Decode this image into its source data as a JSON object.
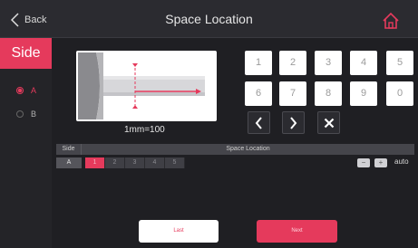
{
  "header": {
    "back_label": "Back",
    "title": "Space Location"
  },
  "sidebar": {
    "title": "Side",
    "options": [
      {
        "label": "A",
        "selected": true
      },
      {
        "label": "B",
        "selected": false
      }
    ]
  },
  "diagram": {
    "scale_label": "1mm=100"
  },
  "keypad": {
    "keys": [
      "1",
      "2",
      "3",
      "4",
      "5",
      "6",
      "7",
      "8",
      "9",
      "0"
    ]
  },
  "location_table": {
    "side_header": "Side",
    "location_header": "Space Location",
    "row": {
      "side": "A",
      "slots": [
        "1",
        "2",
        "3",
        "4",
        "5"
      ],
      "active_slot": "1"
    }
  },
  "controls": {
    "minus": "−",
    "plus": "+",
    "auto": "auto"
  },
  "footer": {
    "last_label": "Last",
    "next_label": "Next"
  },
  "colors": {
    "accent": "#e53a5c",
    "background": "#1f1f23",
    "topbar": "#2b2b30"
  }
}
